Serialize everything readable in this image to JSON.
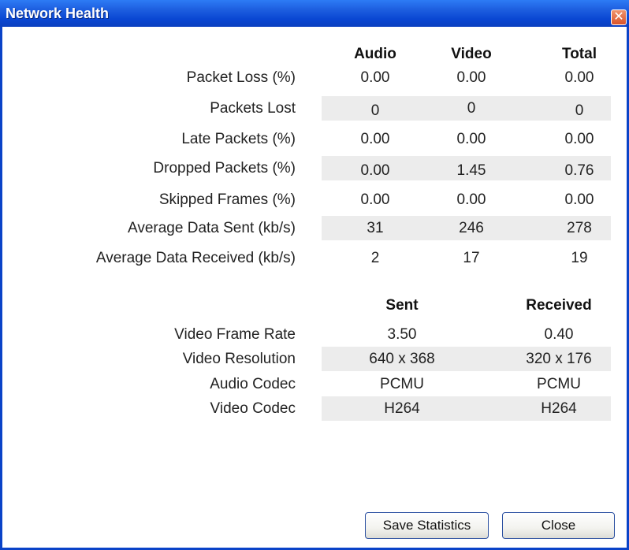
{
  "window": {
    "title": "Network Health",
    "close_glyph": "✕"
  },
  "stats": {
    "headers": [
      "Audio",
      "Video",
      "Total"
    ],
    "rows": [
      {
        "label": "Packet Loss (%)",
        "values": [
          "0.00",
          "0.00",
          "0.00"
        ]
      },
      {
        "label": "Packets Lost",
        "values": [
          "0",
          "0",
          "0"
        ]
      },
      {
        "label": "Late Packets (%)",
        "values": [
          "0.00",
          "0.00",
          "0.00"
        ]
      },
      {
        "label": "Dropped Packets (%)",
        "values": [
          "0.00",
          "1.45",
          "0.76"
        ]
      },
      {
        "label": "Skipped Frames (%)",
        "values": [
          "0.00",
          "0.00",
          "0.00"
        ]
      },
      {
        "label": "Average Data Sent (kb/s)",
        "values": [
          "31",
          "246",
          "278"
        ]
      },
      {
        "label": "Average Data Received (kb/s)",
        "values": [
          "2",
          "17",
          "19"
        ]
      }
    ]
  },
  "media": {
    "headers": [
      "Sent",
      "Received"
    ],
    "rows": [
      {
        "label": "Video Frame Rate",
        "values": [
          "3.50",
          "0.40"
        ]
      },
      {
        "label": "Video Resolution",
        "values": [
          "640 x 368",
          "320 x 176"
        ]
      },
      {
        "label": "Audio Codec",
        "values": [
          "PCMU",
          "PCMU"
        ]
      },
      {
        "label": "Video Codec",
        "values": [
          "H264",
          "H264"
        ]
      }
    ]
  },
  "buttons": {
    "save_label": "Save Statistics",
    "close_label": "Close"
  },
  "colors": {
    "title_bar": "#0a47d3",
    "band": "#ececec",
    "close": "#d9532a"
  }
}
